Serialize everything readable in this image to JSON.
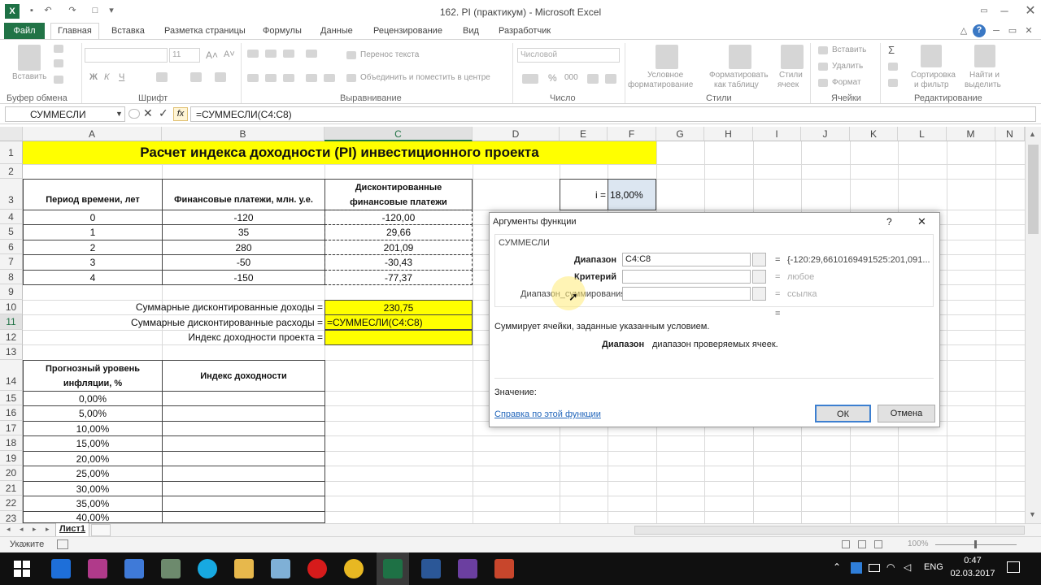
{
  "app": {
    "title": "162. PI (практикум)  -  Microsoft Excel",
    "logo": "X"
  },
  "tabs": [
    "Файл",
    "Главная",
    "Вставка",
    "Разметка страницы",
    "Формулы",
    "Данные",
    "Рецензирование",
    "Вид",
    "Разработчик"
  ],
  "ribbon": {
    "groups": [
      "Буфер обмена",
      "Шрифт",
      "Выравнивание",
      "Число",
      "Стили",
      "Ячейки",
      "Редактирование"
    ],
    "paste": "Вставить",
    "font_size": "11",
    "wrap_text": "Перенос текста",
    "merge_center": "Объединить и поместить в центре",
    "number_format": "Числовой",
    "conditional": [
      "Условное",
      "форматирование"
    ],
    "format_table": [
      "Форматировать",
      "как таблицу"
    ],
    "cell_styles": [
      "Стили",
      "ячеек"
    ],
    "insert": "Вставить",
    "delete": "Удалить",
    "format": "Формат",
    "sort": [
      "Сортировка",
      "и фильтр"
    ],
    "find": [
      "Найти и",
      "выделить"
    ],
    "font_buttons": [
      "Ж",
      "К",
      "Ч"
    ],
    "percent": "%",
    "thousands": "000"
  },
  "formula_bar": {
    "name_box": "СУММЕСЛИ",
    "fx": "fx",
    "formula": "=СУММЕСЛИ(C4:C8)"
  },
  "grid": {
    "columns": [
      "A",
      "B",
      "C",
      "D",
      "E",
      "F",
      "G",
      "H",
      "I",
      "J",
      "K",
      "L",
      "M",
      "N"
    ],
    "rows": [
      "1",
      "2",
      "3",
      "4",
      "5",
      "6",
      "7",
      "8",
      "9",
      "10",
      "11",
      "12",
      "13",
      "14",
      "15",
      "16",
      "17",
      "18",
      "19",
      "20",
      "21",
      "22",
      "23"
    ],
    "title": "Расчет индекса доходности (PI) инвестиционного проекта",
    "headers": {
      "period": "Период времени, лет",
      "payments": "Финансовые платежи, млн. у.е.",
      "discounted_1": "Дисконтированные",
      "discounted_2": "финансовые платежи"
    },
    "rate_label": "i =",
    "rate_value": "18,00%",
    "data_rows": [
      {
        "period": "0",
        "payment": "-120",
        "discounted": "-120,00"
      },
      {
        "period": "1",
        "payment": "35",
        "discounted": "29,66"
      },
      {
        "period": "2",
        "payment": "280",
        "discounted": "201,09"
      },
      {
        "period": "3",
        "payment": "-50",
        "discounted": "-30,43"
      },
      {
        "period": "4",
        "payment": "-150",
        "discounted": "-77,37"
      }
    ],
    "summary": {
      "income_label": "Суммарные дисконтированные доходы =",
      "income_value": "230,75",
      "expense_label": "Суммарные дисконтированные расходы =",
      "expense_formula": "=СУММЕСЛИ(C4:C8)",
      "index_label": "Индекс доходности проекта ="
    },
    "inflation": {
      "header_1": "Прогнозный уровень",
      "header_2": "инфляции, %",
      "index_header": "Индекс доходности",
      "values": [
        "0,00%",
        "5,00%",
        "10,00%",
        "15,00%",
        "20,00%",
        "25,00%",
        "30,00%",
        "35,00%",
        "40,00%"
      ]
    }
  },
  "dialog": {
    "title": "Аргументы функции",
    "help_q": "?",
    "close": "✕",
    "function_name": "СУММЕСЛИ",
    "arg1_label": "Диапазон",
    "arg1_value": "C4:C8",
    "arg1_result": "{-120:29,6610169491525:201,091...",
    "arg2_label": "Критерий",
    "arg2_result": "любое",
    "arg3_label": "Диапазон_суммирования",
    "arg3_result": "ссылка",
    "equals": "=",
    "description": "Суммирует ячейки, заданные указанным условием.",
    "arg_desc_label": "Диапазон",
    "arg_desc": "диапазон проверяемых ячеек.",
    "value_label": "Значение:",
    "help_link": "Справка по этой функции",
    "ok": "ОК",
    "cancel": "Отмена"
  },
  "sheet": {
    "tab": "Лист1"
  },
  "status": {
    "mode": "Укажите",
    "zoom": "100%"
  },
  "taskbar": {
    "lang": "ENG",
    "time": "0:47",
    "date": "02.03.2017"
  },
  "colors": {
    "excel_green": "#217346",
    "highlight": "#ffff00",
    "selected_cell": "#dce6f1"
  }
}
